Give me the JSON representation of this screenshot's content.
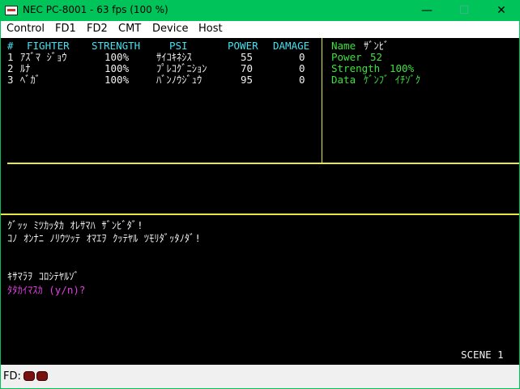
{
  "window": {
    "title": "NEC PC-8001 - 63 fps (100 %)",
    "minimize": "—",
    "maximize": "☐",
    "close": "✕"
  },
  "menu": [
    "Control",
    "FD1",
    "FD2",
    "CMT",
    "Device",
    "Host"
  ],
  "table": {
    "header": {
      "num": "#",
      "fighter": "FIGHTER",
      "strength": "STRENGTH",
      "psi": "PSI",
      "power": "POWER",
      "damage": "DAMAGE"
    },
    "rows": [
      {
        "num": "1",
        "fighter": "ｱｽﾞﾏ ｼﾞｮｳ",
        "strength": "100%",
        "psi": "ｻｲｺｷﾈｼｽ",
        "power": "55",
        "damage": "0"
      },
      {
        "num": "2",
        "fighter": "ﾙﾅ",
        "strength": "100%",
        "psi": "ﾌﾟﾚｺｸﾞﾆｼｮﾝ",
        "power": "70",
        "damage": "0"
      },
      {
        "num": "3",
        "fighter": "ﾍﾞｶﾞ",
        "strength": "100%",
        "psi": "ﾊﾞﾝﾉｳｼﾞｭｳ",
        "power": "95",
        "damage": "0"
      }
    ]
  },
  "enemy": {
    "name_label": "Name",
    "name_value": "ｻﾞﾝﾋﾞ",
    "power_label": "Power",
    "power_value": "52",
    "strength_label": "Strength",
    "strength_value": "100%",
    "data_label": "Data",
    "data_value": "ｹﾞﾝﾌﾞ ｲﾁｿﾞｸ"
  },
  "messages": {
    "line1": "ｸﾞｯｯ ﾐﾂｶｯﾀｶ ｵﾚｻﾏﾊ ｻﾞﾝﾋﾞﾀﾞ!",
    "line2": "ｺﾉ ｵﾝﾅﾆ ﾉﾘｳﾂｯﾃ ｵﾏｴｦ ｸｯﾃﾔﾙ ﾂﾓﾘﾀﾞｯﾀﾉﾀﾞ!",
    "line3": "ｷｻﾏﾗｦ ｺﾛｼﾃﾔﾙｿﾞ",
    "prompt": "ﾀﾀｶｲﾏｽｶ (y/n)?"
  },
  "scene": "SCENE 1",
  "status": {
    "fd_label": "FD:"
  },
  "colors": {
    "titlebar": "#00c45a",
    "cyan": "#44e0f0",
    "green": "#40e040",
    "magenta": "#e040e0",
    "divider": "#e8e840",
    "led": "#7a1010"
  }
}
